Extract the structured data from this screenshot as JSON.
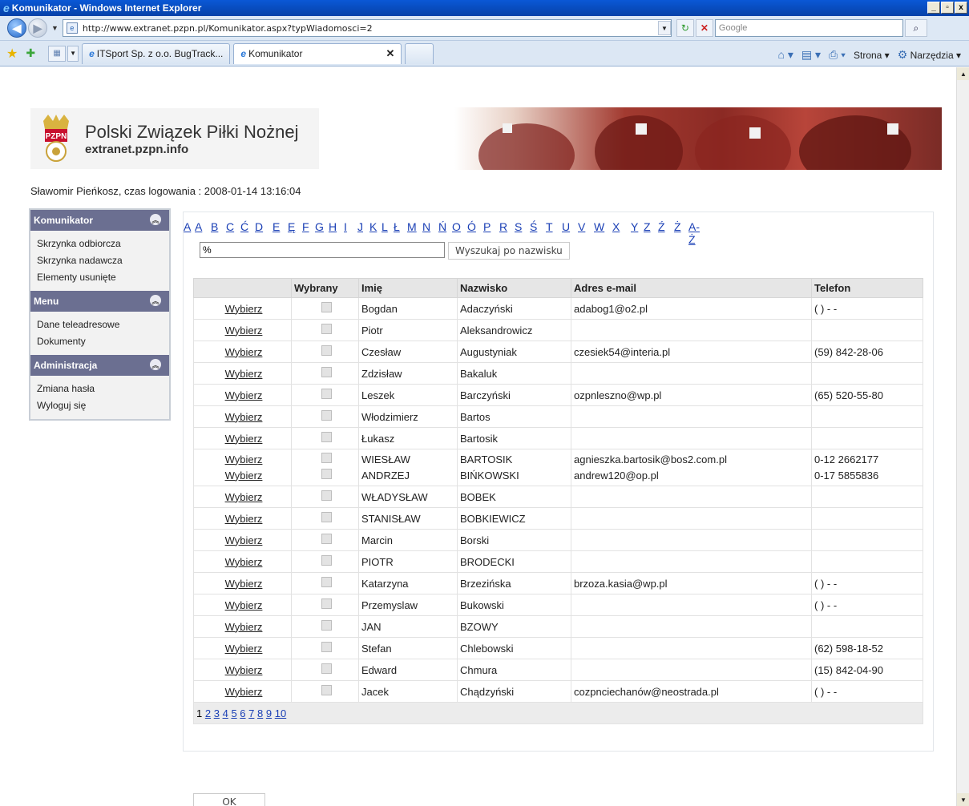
{
  "window": {
    "title": "Komunikator - Windows Internet Explorer",
    "minimize": "_",
    "maximize": "▫",
    "close": "x"
  },
  "address": {
    "url": "http://www.extranet.pzpn.pl/Komunikator.aspx?typWiadomosci=2",
    "search_placeholder": "Google"
  },
  "tabs": [
    {
      "label": "ITSport Sp. z o.o. BugTrack..."
    },
    {
      "label": "Komunikator"
    }
  ],
  "command_bar": {
    "page": "Strona",
    "tools": "Narzędzia"
  },
  "site": {
    "title": "Polski Związek Piłki Nożnej",
    "subtitle": "extranet.pzpn.info",
    "crest_text": "PZPN"
  },
  "login_info": "Sławomir Pieńkosz, czas logowania : 2008-01-14 13:16:04",
  "sidebar": [
    {
      "title": "Komunikator",
      "items": [
        "Skrzynka odbiorcza",
        "Skrzynka nadawcza",
        "Elementy usunięte"
      ]
    },
    {
      "title": "Menu",
      "items": [
        "Dane teleadresowe",
        "Dokumenty"
      ]
    },
    {
      "title": "Administracja",
      "items": [
        "Zmiana hasła",
        "Wyloguj się"
      ]
    }
  ],
  "alphabet": [
    "A",
    "A",
    "B",
    "C",
    "Ć",
    "D",
    "E",
    "Ę",
    "F",
    "G",
    "H",
    "I",
    "J",
    "K",
    "L",
    "Ł",
    "M",
    "N",
    "Ń",
    "O",
    "Ó",
    "P",
    "R",
    "S",
    "Ś",
    "T",
    "U",
    "V",
    "W",
    "X",
    "Y",
    "Z",
    "Ź",
    "Ż",
    "A-Ż"
  ],
  "search": {
    "value": "%",
    "button": "Wyszukaj po nazwisku"
  },
  "table": {
    "headers": [
      "",
      "Wybrany",
      "Imię",
      "Nazwisko",
      "Adres e-mail",
      "Telefon"
    ],
    "select_label": "Wybierz",
    "rows": [
      {
        "first": [
          "Bogdan"
        ],
        "last": [
          "Adaczyński"
        ],
        "email": [
          "adabog1@o2.pl"
        ],
        "phone": [
          "( ) - -"
        ]
      },
      {
        "first": [
          "Piotr"
        ],
        "last": [
          "Aleksandrowicz"
        ],
        "email": [
          ""
        ],
        "phone": [
          ""
        ]
      },
      {
        "first": [
          "Czesław"
        ],
        "last": [
          "Augustyniak"
        ],
        "email": [
          "czesiek54@interia.pl"
        ],
        "phone": [
          "(59) 842-28-06"
        ]
      },
      {
        "first": [
          "Zdzisław"
        ],
        "last": [
          "Bakaluk"
        ],
        "email": [
          ""
        ],
        "phone": [
          ""
        ]
      },
      {
        "first": [
          "Leszek"
        ],
        "last": [
          "Barczyński"
        ],
        "email": [
          "ozpnleszno@wp.pl"
        ],
        "phone": [
          "(65) 520-55-80"
        ]
      },
      {
        "first": [
          "Włodzimierz"
        ],
        "last": [
          "Bartos"
        ],
        "email": [
          ""
        ],
        "phone": [
          ""
        ]
      },
      {
        "first": [
          "Łukasz"
        ],
        "last": [
          "Bartosik"
        ],
        "email": [
          ""
        ],
        "phone": [
          ""
        ]
      },
      {
        "first": [
          "WIESŁAW",
          "ANDRZEJ"
        ],
        "last": [
          "BARTOSIK",
          "BIŃKOWSKI"
        ],
        "email": [
          "agnieszka.bartosik@bos2.com.pl",
          "andrew120@op.pl"
        ],
        "phone": [
          "0-12 2662177",
          "0-17 5855836"
        ]
      },
      {
        "first": [
          "WŁADYSŁAW"
        ],
        "last": [
          "BOBEK"
        ],
        "email": [
          ""
        ],
        "phone": [
          ""
        ]
      },
      {
        "first": [
          "STANISŁAW"
        ],
        "last": [
          "BOBKIEWICZ"
        ],
        "email": [
          ""
        ],
        "phone": [
          ""
        ]
      },
      {
        "first": [
          "Marcin"
        ],
        "last": [
          "Borski"
        ],
        "email": [
          ""
        ],
        "phone": [
          ""
        ]
      },
      {
        "first": [
          "PIOTR"
        ],
        "last": [
          "BRODECKI"
        ],
        "email": [
          ""
        ],
        "phone": [
          ""
        ]
      },
      {
        "first": [
          "Katarzyna"
        ],
        "last": [
          "Brzezińska"
        ],
        "email": [
          "brzoza.kasia@wp.pl"
        ],
        "phone": [
          "( ) - -"
        ]
      },
      {
        "first": [
          "Przemyslaw"
        ],
        "last": [
          "Bukowski"
        ],
        "email": [
          ""
        ],
        "phone": [
          "( ) - -"
        ]
      },
      {
        "first": [
          "JAN"
        ],
        "last": [
          "BZOWY"
        ],
        "email": [
          ""
        ],
        "phone": [
          ""
        ]
      },
      {
        "first": [
          "Stefan"
        ],
        "last": [
          "Chlebowski"
        ],
        "email": [
          ""
        ],
        "phone": [
          "(62) 598-18-52"
        ]
      },
      {
        "first": [
          "Edward"
        ],
        "last": [
          "Chmura"
        ],
        "email": [
          ""
        ],
        "phone": [
          "(15) 842-04-90"
        ]
      },
      {
        "first": [
          "Jacek"
        ],
        "last": [
          "Chądzyński"
        ],
        "email": [
          "cozpnciechanów@neostrada.pl"
        ],
        "phone": [
          "( ) - -"
        ]
      }
    ]
  },
  "pager": {
    "current": "1",
    "pages": [
      "2",
      "3",
      "4",
      "5",
      "6",
      "7",
      "8",
      "9",
      "10"
    ]
  },
  "ok_button": "OK",
  "colors": {
    "link": "#1a3fb5",
    "sidebar_header": "#6b6f91",
    "titlebar": "#0641a8"
  }
}
